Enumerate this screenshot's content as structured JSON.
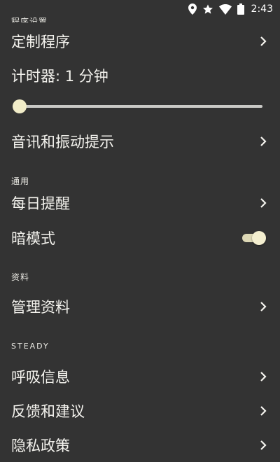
{
  "status_bar": {
    "time": "2:43",
    "icons": [
      "location-icon",
      "star-icon",
      "wifi-icon",
      "battery-icon"
    ]
  },
  "sections": {
    "program_header": "程序设置",
    "general_header": "通用",
    "data_header": "资料",
    "steady_header": "STEADY"
  },
  "items": {
    "custom_program": "定制程序",
    "timer": "计时器: 1 分钟",
    "sound_vibration": "音讯和振动提示",
    "daily_reminder": "每日提醒",
    "dark_mode": "暗模式",
    "manage_data": "管理资料",
    "breathing_info": "呼吸信息",
    "feedback": "反馈和建议",
    "privacy_policy": "隐私政策"
  },
  "timer_slider": {
    "value_fraction": 0.0
  },
  "dark_mode_toggle": {
    "on": true
  },
  "colors": {
    "background": "#333333",
    "text": "#f4f3ee",
    "accent": "#f1ecc8"
  }
}
